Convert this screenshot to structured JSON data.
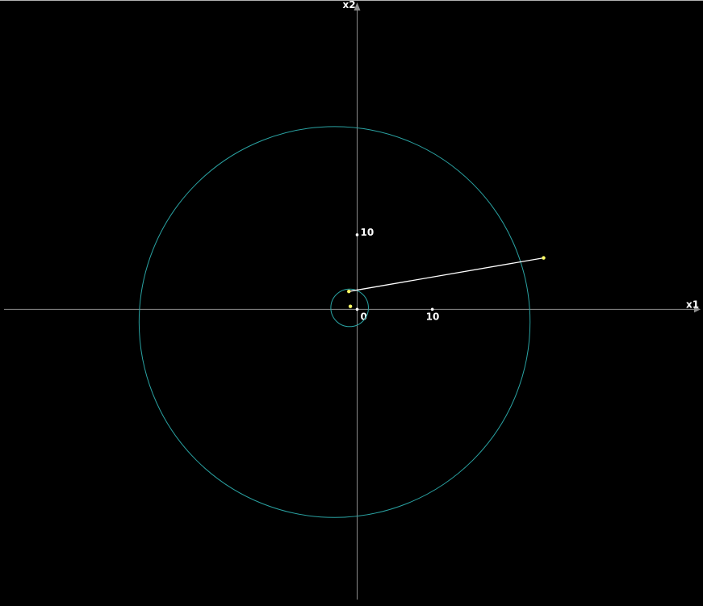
{
  "axes": {
    "x_label": "x1",
    "y_label": "x2",
    "x_tick_label": "10",
    "y_tick_label": "10",
    "origin_label": "0"
  },
  "colors": {
    "background": "#000000",
    "axis": "#8c8c8c",
    "circle": "#2aa3a3",
    "segment": "#ffffff",
    "point": "#ffff66",
    "tick_point": "#ffffff",
    "frame_top": "#b3b3b3"
  },
  "geometry": {
    "units": "data",
    "x_range": [
      -47.5,
      46
    ],
    "y_range": [
      -39.8,
      41.5
    ],
    "ticks": {
      "x": 10,
      "y": 10
    },
    "big_circle": {
      "center": [
        -3.0,
        -1.7
      ],
      "radius": 26.0
    },
    "small_circle": {
      "center": [
        -1.0,
        0.2
      ],
      "radius": 2.5
    },
    "segment": {
      "from": [
        -1.1,
        2.4
      ],
      "to": [
        24.8,
        6.9
      ]
    },
    "points": [
      {
        "id": "inner-point",
        "at": [
          -0.9,
          0.4
        ]
      },
      {
        "id": "segment-start",
        "at": [
          -1.1,
          2.4
        ]
      },
      {
        "id": "segment-end",
        "at": [
          24.8,
          6.9
        ]
      }
    ]
  }
}
